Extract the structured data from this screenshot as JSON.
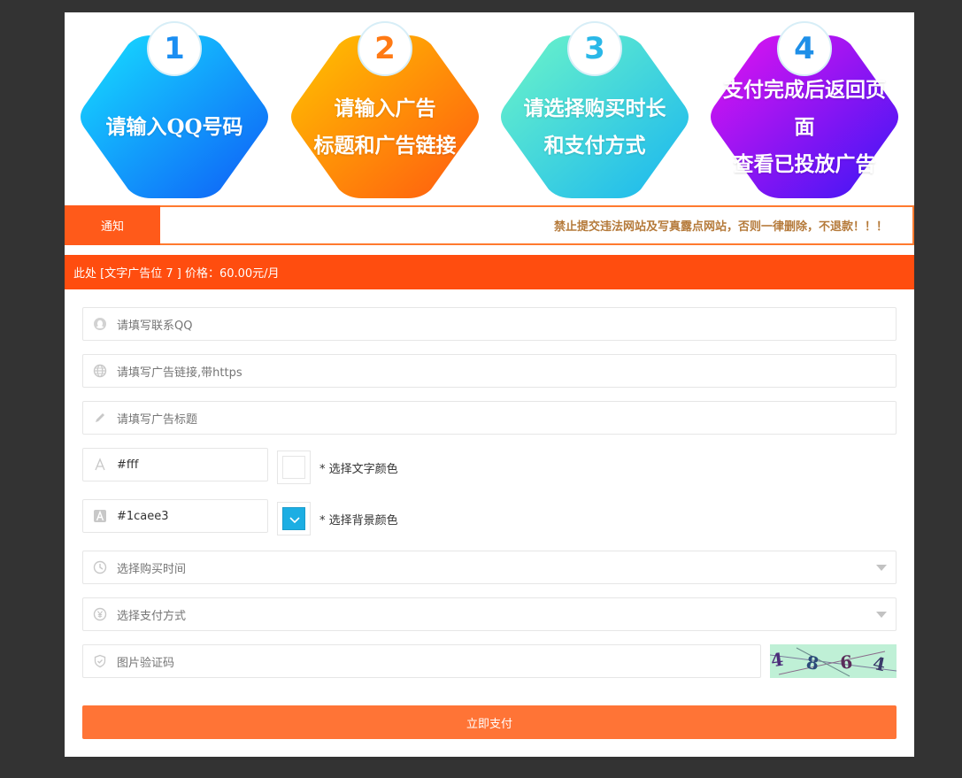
{
  "steps": [
    {
      "number": "1",
      "lines": [
        "请输入QQ号码"
      ],
      "number_color": "#1b8ef2"
    },
    {
      "number": "2",
      "lines": [
        "请输入广告",
        "标题和广告链接"
      ],
      "number_color": "#ff7a14"
    },
    {
      "number": "3",
      "lines": [
        "请选择购买时长",
        "和支付方式"
      ],
      "number_color": "#2ab8e8"
    },
    {
      "number": "4",
      "lines": [
        "支付完成后返回页面",
        "查看已投放广告"
      ],
      "number_color": "#1e8fe8"
    }
  ],
  "notice": {
    "tag": "通知",
    "text": "禁止提交违法网站及写真露点网站，否则一律删除，不退款！！！"
  },
  "price_bar": {
    "text": "此处 [文字广告位 7 ] 价格：60.00元/月"
  },
  "form": {
    "qq": {
      "placeholder": "请填写联系QQ",
      "icon": "qq-icon"
    },
    "link": {
      "placeholder": "请填写广告链接,带https",
      "icon": "globe-icon"
    },
    "title": {
      "placeholder": "请填写广告标题",
      "icon": "pencil-icon"
    },
    "text_color": {
      "value": "#fff",
      "label": "* 选择文字颜色",
      "swatch": "#ffffff",
      "icon": "font-icon"
    },
    "bg_color": {
      "value": "#1caee3",
      "label": "* 选择背景颜色",
      "swatch": "#1caee3",
      "icon": "font-filled-icon"
    },
    "duration": {
      "placeholder": "选择购买时间",
      "icon": "clock-icon"
    },
    "payment": {
      "placeholder": "选择支付方式",
      "icon": "yen-icon"
    },
    "captcha": {
      "placeholder": "图片验证码",
      "icon": "shield-icon",
      "image_text": "4864"
    },
    "submit_label": "立即支付"
  },
  "colors": {
    "accent": "#ff4d0f",
    "submit": "#ff7436",
    "notice_text": "#b57a3a"
  }
}
